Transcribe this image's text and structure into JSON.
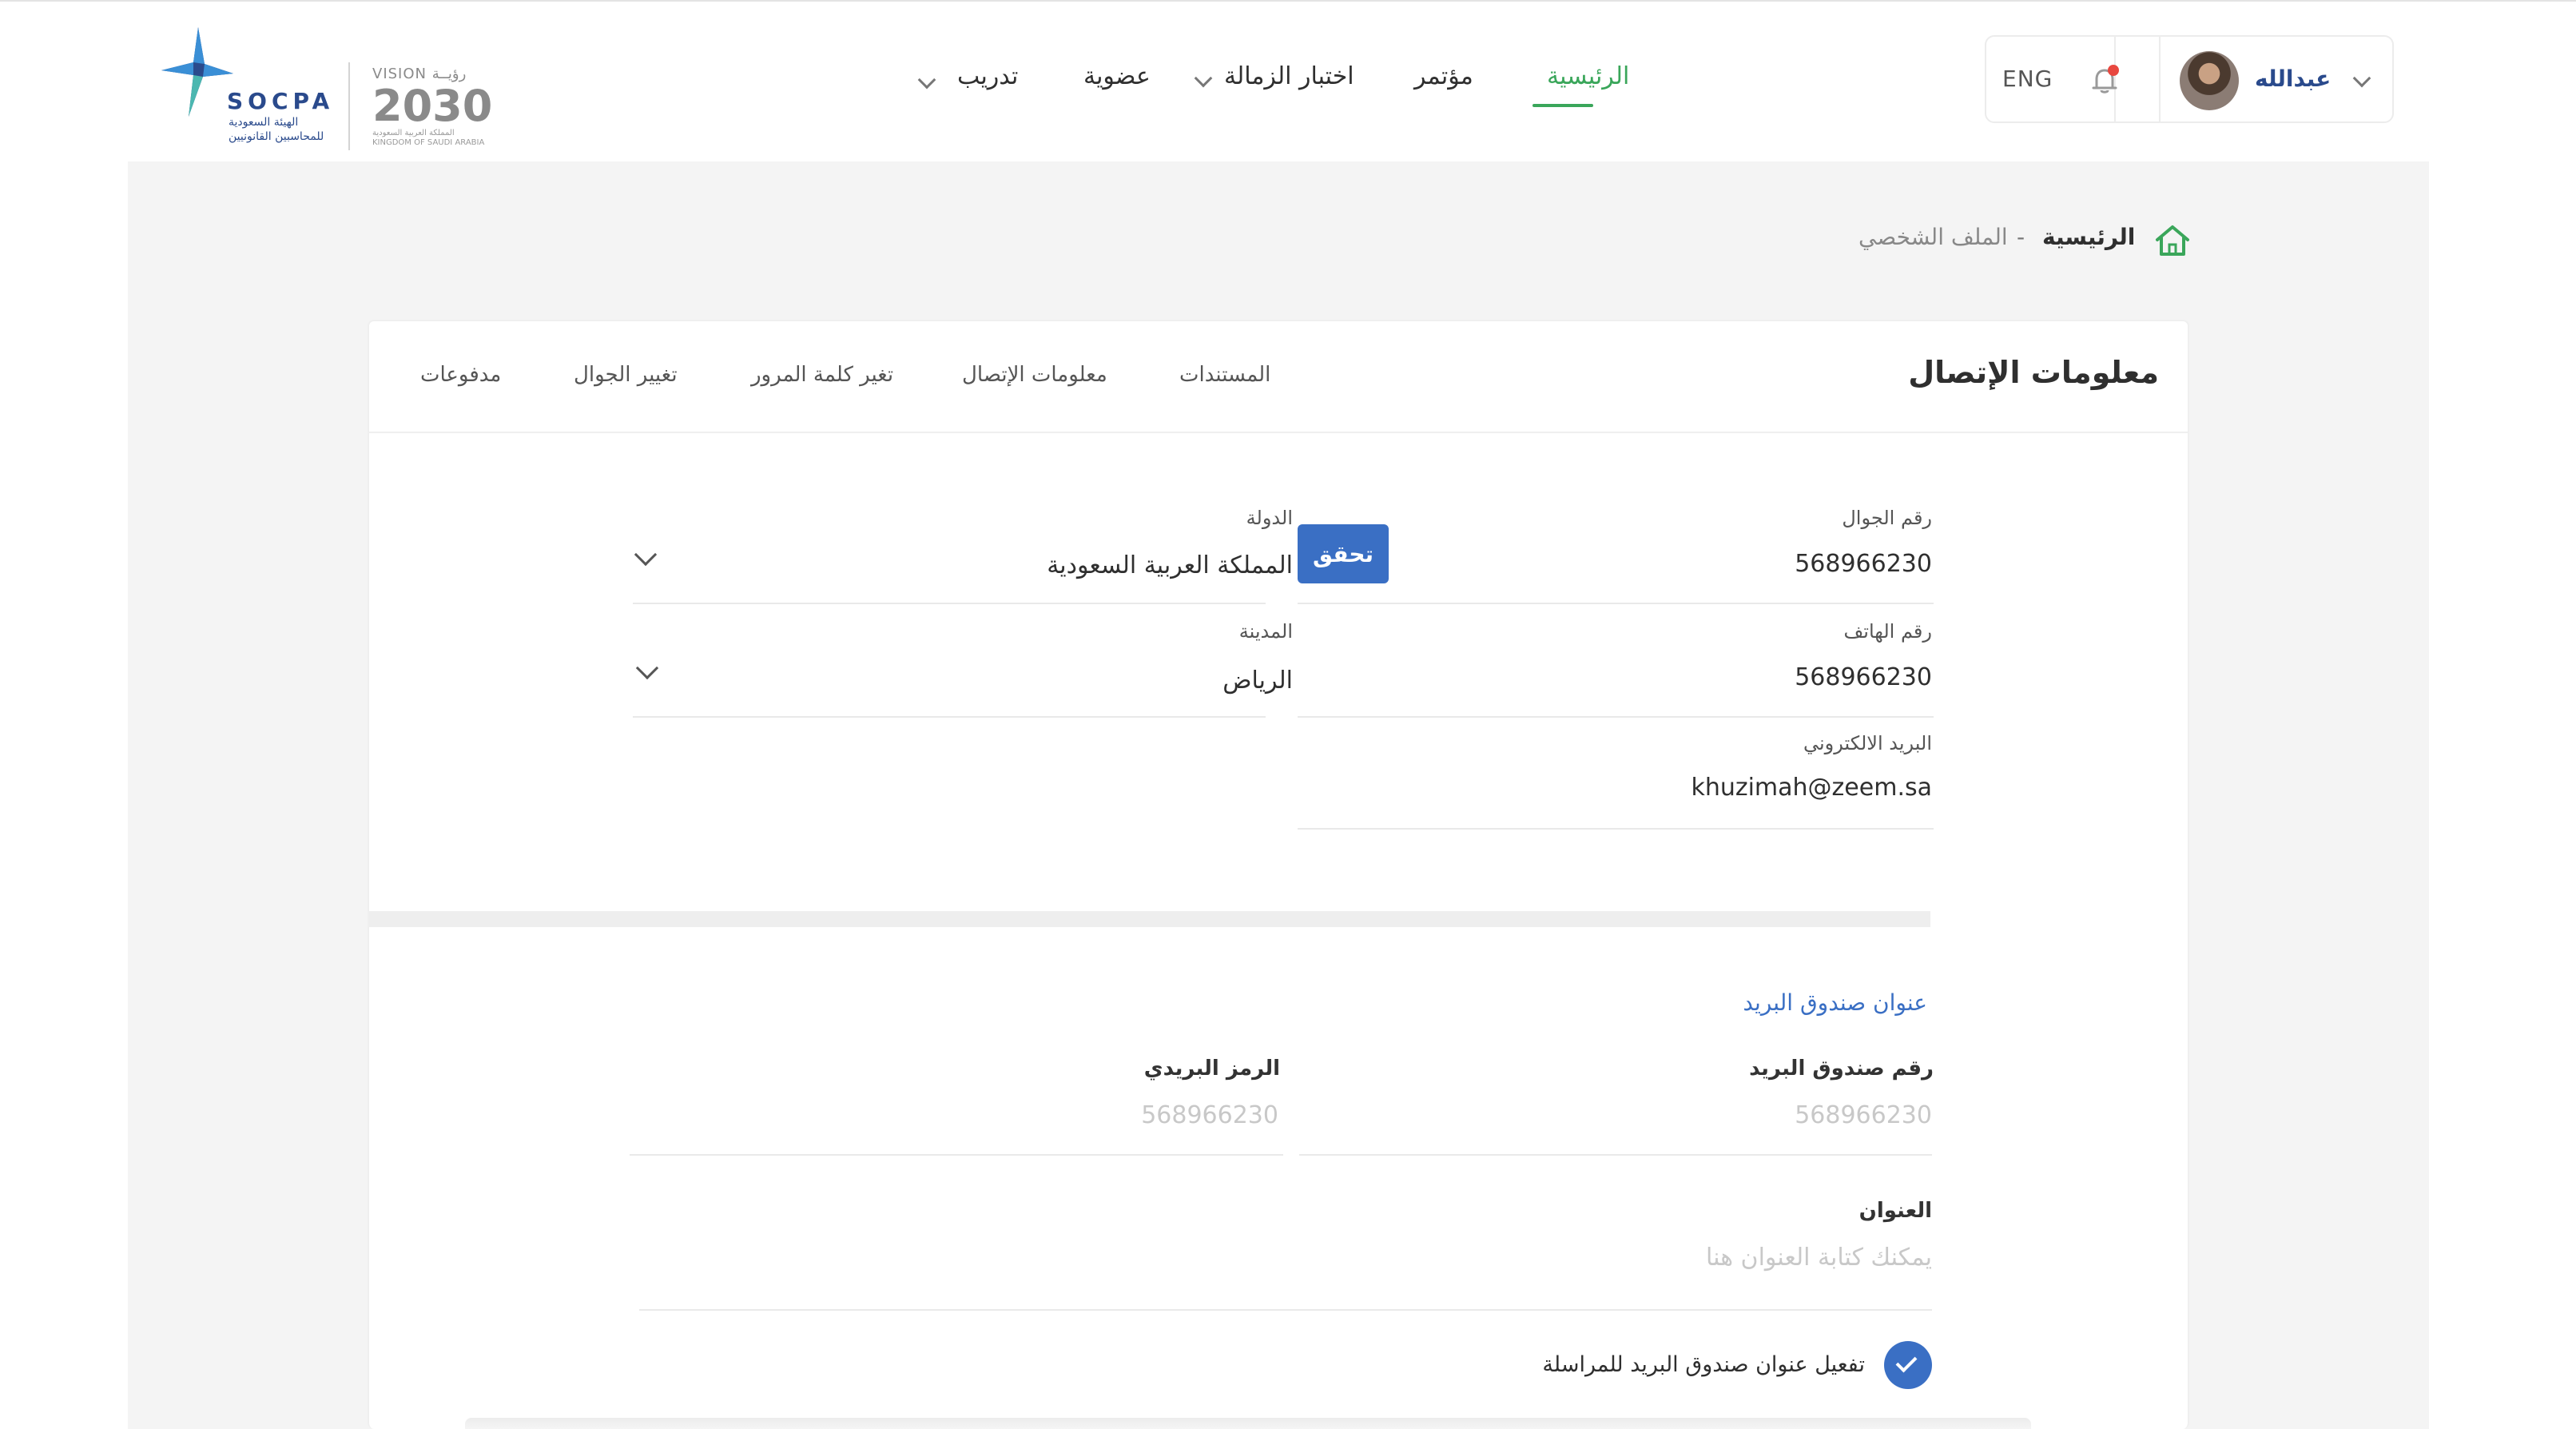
{
  "header": {
    "logo": {
      "socpa": "SOCPA",
      "socpa_ar": "الهيئة السعودية للمحاسبين القانونيين",
      "vision_top": "VISION رؤيــة",
      "vision_year": "2030",
      "vision_ar": "المملكة العربية السعودية KINGDOM OF SAUDI ARABIA"
    },
    "nav": {
      "home": "الرئيسية",
      "conference": "مؤتمر",
      "fellowship": "اختبار الزمالة",
      "membership": "عضوية",
      "training": "تدريب"
    },
    "lang": "ENG",
    "user_name": "عبدالله"
  },
  "breadcrumb": {
    "home": "الرئيسية",
    "separator": "-",
    "current": "الملف الشخصي"
  },
  "card": {
    "title": "معلومات الإتصال",
    "tabs": [
      "المستندات",
      "معلومات الإتصال",
      "تغير كلمة المرور",
      "تغيير الجوال",
      "مدفوعات"
    ]
  },
  "contact": {
    "mobile_label": "رقم الجوال",
    "mobile_value": "568966230",
    "verify_label": "تحقق",
    "phone_label": "رقم الهاتف",
    "phone_value": "568966230",
    "email_label": "البريد الالكتروني",
    "email_value": "khuzimah@zeem.sa",
    "country_label": "الدولة",
    "country_value": "المملكة العربية السعودية",
    "city_label": "المدينة",
    "city_value": "الرياض"
  },
  "po_box": {
    "section_title": "عنوان صندوق البريد",
    "box_label": "رقم صندوق البريد",
    "box_placeholder": "568966230",
    "zip_label": "الرمز البريدي",
    "zip_placeholder": "568966230",
    "address_label": "العنوان",
    "address_placeholder": "يمكنك كتابة العنوان هنا",
    "activate_label": "تفعيل عنوان صندوق البريد للمراسلة",
    "activate_checked": true
  },
  "colors": {
    "accent_green": "#3aa65a",
    "accent_blue": "#3a6fc4",
    "notification_dot": "#e8473f"
  }
}
